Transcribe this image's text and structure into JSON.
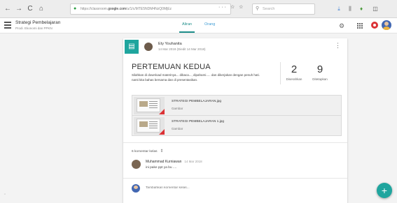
{
  "browser": {
    "back": "←",
    "forward": "→",
    "reload": "C",
    "home": "⌂",
    "url_prefix": "https://classroom.",
    "url_domain": "google.com",
    "url_path": "/u/1/c/MTE5NDM4NzQ0MjEz",
    "page_actions": "··· ☆ ☆",
    "search_placeholder": "Search"
  },
  "appbar": {
    "title": "Strategi Pembelajaran",
    "subtitle": "Prodi. Ekonomi dan PPKN",
    "tabs": [
      {
        "label": "Aliran"
      },
      {
        "label": "Orang"
      }
    ]
  },
  "post": {
    "author": "Ety Youhanita",
    "date": "14 Mar 2018 (Diedit 14 Mar 2018)",
    "title": "PERTEMUAN KEDUA",
    "description_1": "Silahkan di download materinya... dibaca..., dipahami..... dan dikerjakan dengan penuh hati.",
    "description_2": "nanti kita bahas bersama dan di presentasikan.",
    "stats": [
      {
        "value": "2",
        "label": "Diserahkan"
      },
      {
        "value": "9",
        "label": "Ditetapkan"
      }
    ],
    "attachments": [
      {
        "name": "STRATEGI PEMBELAJARAN.jpg",
        "type": "Gambar"
      },
      {
        "name": "STRATEGI PEMBELAJARAN 1.jpg",
        "type": "Gambar"
      }
    ],
    "comments_label": "6 komentar kelas",
    "comment": {
      "author": "Muhammad Kurniawan",
      "date": "14 Mar 2018",
      "text": "ini pake ppt ya bu ...."
    },
    "comment_placeholder": "Tambahkan komentar kelas..."
  },
  "fab_label": "+",
  "colors": {
    "accent": "#1fa59e",
    "tab_active": "#1e8e8a",
    "link": "#3d9bd4",
    "alert": "#db3236"
  }
}
